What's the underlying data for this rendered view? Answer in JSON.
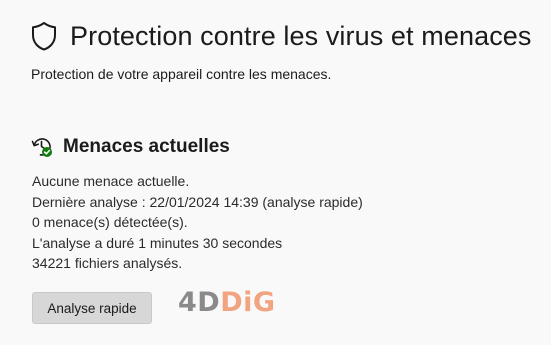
{
  "header": {
    "title": "Protection contre les virus et menaces",
    "subtitle": "Protection de votre appareil contre les menaces.",
    "icon": "shield-icon"
  },
  "current_threats": {
    "icon": "clock-refresh-check-icon",
    "title": "Menaces actuelles",
    "lines": [
      "Aucune menace actuelle.",
      "Dernière analyse : 22/01/2024 14:39 (analyse rapide)",
      "0 menace(s) détectée(s).",
      "L'analyse a duré 1 minutes 30 secondes",
      "34221 fichiers analysés."
    ],
    "quick_scan_label": "Analyse rapide"
  },
  "watermark": {
    "part1": "4D",
    "part2": "DiG",
    "colors": {
      "part1": "#8a8a8a",
      "part2": "#f2a37f"
    }
  },
  "colors": {
    "background": "#f9f9f9",
    "text": "#1b1b1b",
    "button_bg": "#d7d7d7",
    "status_ok": "#107c10"
  }
}
